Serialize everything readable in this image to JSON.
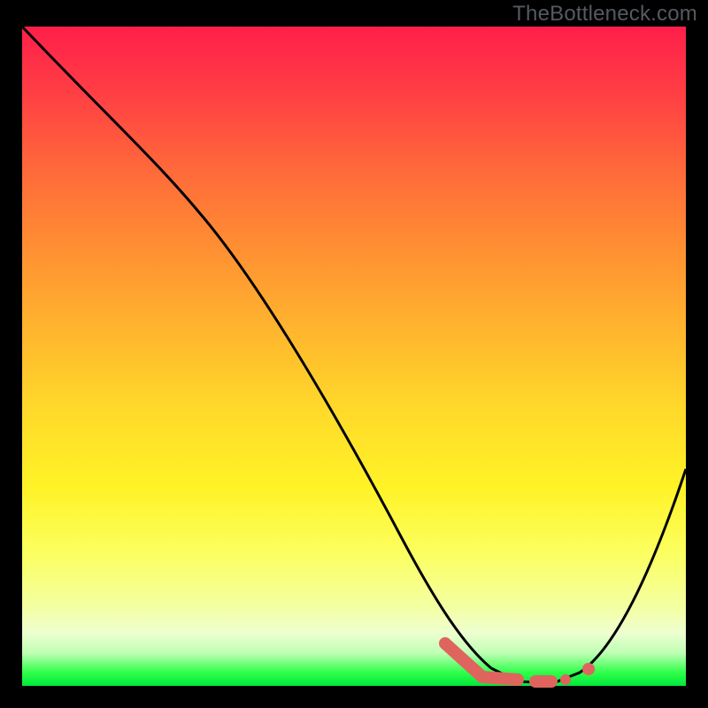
{
  "watermark": "TheBottleneck.com",
  "chart_data": {
    "type": "line",
    "title": "",
    "xlabel": "",
    "ylabel": "",
    "xlim": [
      0,
      100
    ],
    "ylim": [
      0,
      100
    ],
    "series": [
      {
        "name": "bottleneck-curve",
        "x": [
          0,
          12,
          24,
          36,
          48,
          60,
          65,
          72,
          75,
          80,
          85,
          90,
          95,
          100
        ],
        "y": [
          100,
          90,
          78,
          62,
          46,
          30,
          18,
          6,
          2,
          0,
          2,
          10,
          25,
          45
        ]
      }
    ],
    "highlight": {
      "name": "recommended-range",
      "x_start": 64,
      "x_end": 83,
      "y": 1
    },
    "colors": {
      "curve": "#000000",
      "highlight": "#e0645e",
      "gradient_top": "#ff1f4a",
      "gradient_bottom": "#00e83a"
    }
  }
}
